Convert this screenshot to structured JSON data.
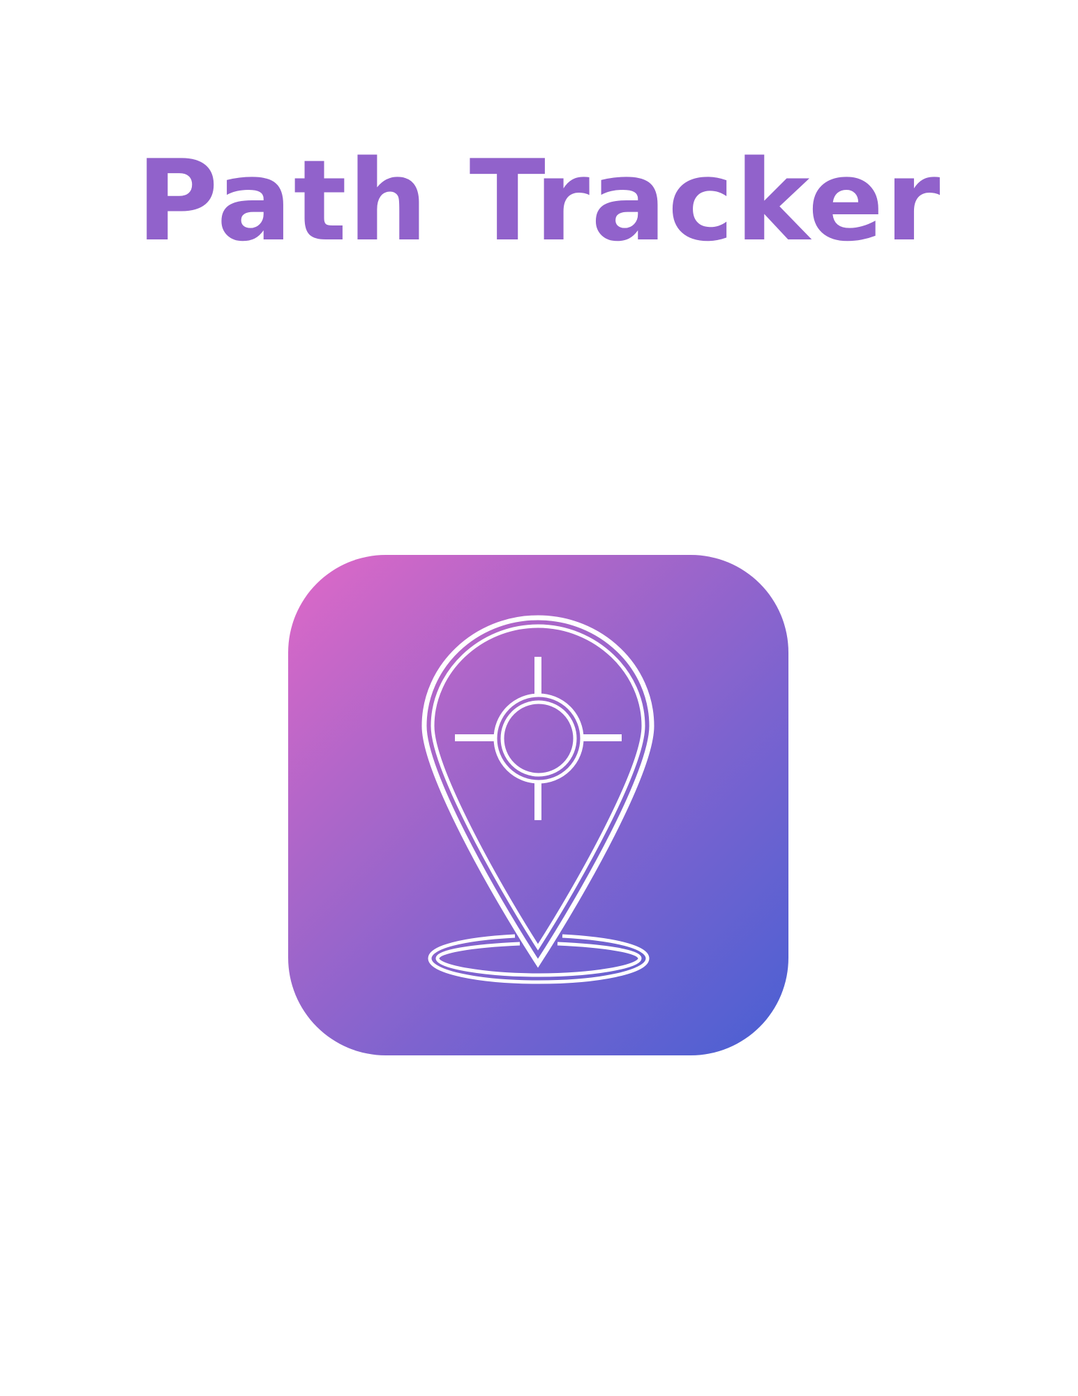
{
  "header": {
    "title": "Path Tracker"
  },
  "icon": {
    "name": "location-target-pin-icon",
    "gradient_start": "#df68c8",
    "gradient_end": "#4960d3",
    "stroke_color": "#ffffff"
  },
  "colors": {
    "title": "#9162cb",
    "background": "#ffffff"
  }
}
